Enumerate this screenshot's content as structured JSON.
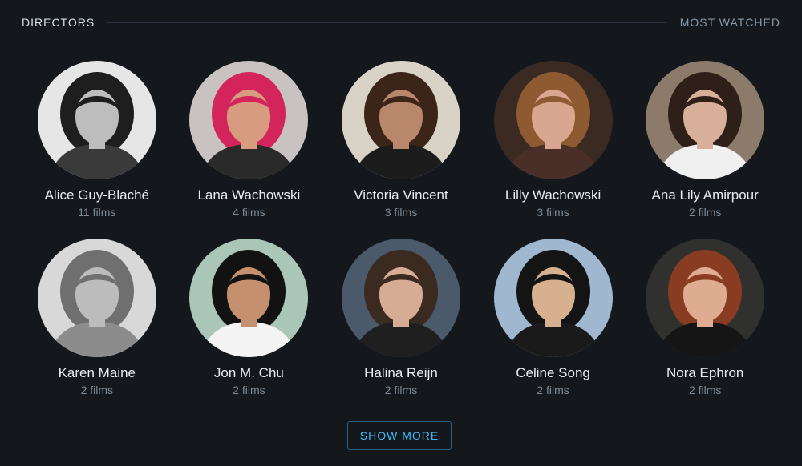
{
  "header": {
    "title": "DIRECTORS",
    "sort_link": "MOST WATCHED"
  },
  "directors": [
    {
      "name": "Alice Guy-Blaché",
      "films": "11 films",
      "portrait": {
        "bg": "#e6e6e6",
        "hair": "#1e1e1e",
        "skin": "#bdbdbd",
        "cloth": "#3a3a3a"
      }
    },
    {
      "name": "Lana Wachowski",
      "films": "4 films",
      "portrait": {
        "bg": "#c8c2c2",
        "hair": "#d4245c",
        "skin": "#d79c80",
        "cloth": "#2a2a2a"
      }
    },
    {
      "name": "Victoria Vincent",
      "films": "3 films",
      "portrait": {
        "bg": "#d9d2c6",
        "hair": "#3b2418",
        "skin": "#b9876c",
        "cloth": "#1c1c1c"
      }
    },
    {
      "name": "Lilly Wachowski",
      "films": "3 films",
      "portrait": {
        "bg": "#3a2a22",
        "hair": "#8d5a32",
        "skin": "#d9a690",
        "cloth": "#4a2e28"
      }
    },
    {
      "name": "Ana Lily Amirpour",
      "films": "2 films",
      "portrait": {
        "bg": "#8c7a6a",
        "hair": "#2e1f19",
        "skin": "#d8b09a",
        "cloth": "#f0f0f0"
      }
    },
    {
      "name": "Karen Maine",
      "films": "2 films",
      "portrait": {
        "bg": "#d8d8d8",
        "hair": "#6f6f6f",
        "skin": "#bcbcbc",
        "cloth": "#8c8c8c"
      }
    },
    {
      "name": "Jon M. Chu",
      "films": "2 films",
      "portrait": {
        "bg": "#a9c6b9",
        "hair": "#121212",
        "skin": "#c4906e",
        "cloth": "#f4f4f4"
      }
    },
    {
      "name": "Halina Reijn",
      "films": "2 films",
      "portrait": {
        "bg": "#4a5a6a",
        "hair": "#3b2a20",
        "skin": "#d6ac94",
        "cloth": "#1f1f1f"
      }
    },
    {
      "name": "Celine Song",
      "films": "2 films",
      "portrait": {
        "bg": "#9fb7cf",
        "hair": "#141414",
        "skin": "#d7b08f",
        "cloth": "#1a1a1a"
      }
    },
    {
      "name": "Nora Ephron",
      "films": "2 films",
      "portrait": {
        "bg": "#30302e",
        "hair": "#8a3c22",
        "skin": "#deac90",
        "cloth": "#151515"
      }
    }
  ],
  "show_more_label": "SHOW MORE"
}
